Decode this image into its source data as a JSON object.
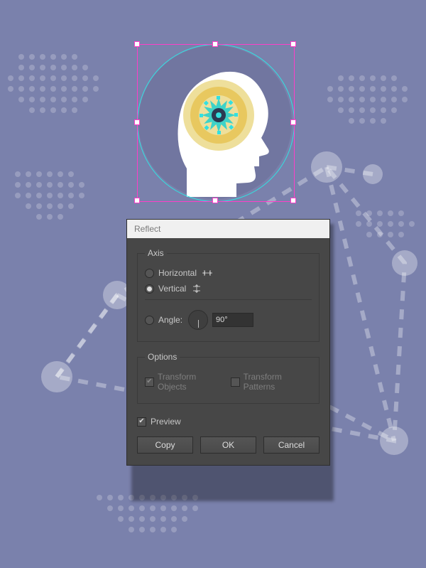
{
  "dialog": {
    "title": "Reflect",
    "axis": {
      "legend": "Axis",
      "horizontal": "Horizontal",
      "vertical": "Vertical",
      "angle_label": "Angle:",
      "angle_value": "90°",
      "selected": "vertical"
    },
    "options": {
      "legend": "Options",
      "transform_objects": "Transform Objects",
      "transform_patterns": "Transform Patterns",
      "transform_objects_checked": true,
      "transform_patterns_checked": false
    },
    "preview": {
      "label": "Preview",
      "checked": true
    },
    "buttons": {
      "copy": "Copy",
      "ok": "OK",
      "cancel": "Cancel"
    }
  },
  "artwork": {
    "selected_object": "head-icon-group",
    "selection_color_bbox": "#ff3ec8",
    "selection_color_path": "#33e0e0",
    "head_fill": "#ffffff",
    "circle_bg": "#7a81ac",
    "ring_outer": "#eedf9b",
    "ring_mid": "#e8c85f",
    "ring_inner": "#eedf9b",
    "burst": "#3ed2c8",
    "burst_center": "#2c3a52"
  },
  "background": {
    "network_color": "rgba(255,255,255,0.28)",
    "dot_color": "rgba(255,255,255,0.22)"
  }
}
